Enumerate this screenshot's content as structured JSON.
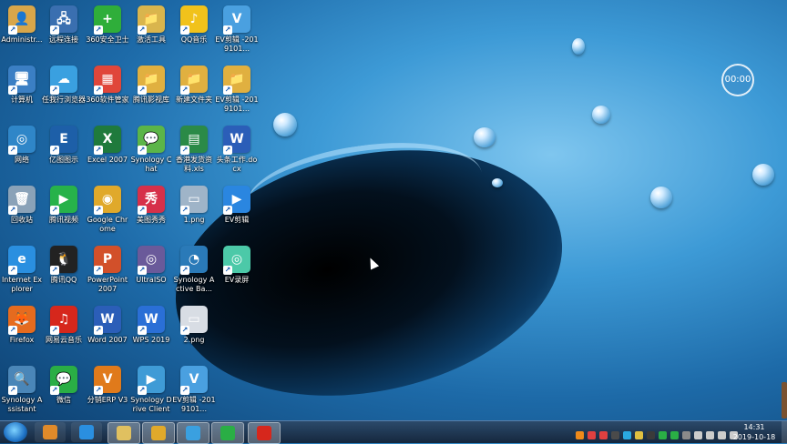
{
  "desktop": {
    "clock_bubble": "00:00",
    "icons": [
      {
        "label": "Administr...",
        "glyph": "👤",
        "color": "#d8a64a",
        "icon": "user-folder-icon"
      },
      {
        "label": "计算机",
        "glyph": "🖥",
        "color": "#3b7fc4",
        "icon": "computer-icon"
      },
      {
        "label": "网络",
        "glyph": "◎",
        "color": "#2f86c8",
        "icon": "network-icon"
      },
      {
        "label": "回收站",
        "glyph": "🗑",
        "color": "#8aa2b8",
        "icon": "recycle-bin-icon"
      },
      {
        "label": "Internet Explorer",
        "glyph": "e",
        "color": "#2a8fe0",
        "icon": "internet-explorer-icon"
      },
      {
        "label": "Firefox",
        "glyph": "🦊",
        "color": "#e56b1f",
        "icon": "firefox-icon"
      },
      {
        "label": "Synology Assistant",
        "glyph": "🔍",
        "color": "#4a86b8",
        "icon": "synology-assistant-icon"
      },
      {
        "label": "远程连接",
        "glyph": "🖧",
        "color": "#3a6fb0",
        "icon": "remote-desktop-icon"
      },
      {
        "label": "任我行浏览器",
        "glyph": "☁",
        "color": "#3aa0e0",
        "icon": "browser-icon"
      },
      {
        "label": "亿图图示",
        "glyph": "E",
        "color": "#1d5fa8",
        "icon": "edraw-icon"
      },
      {
        "label": "腾讯视频",
        "glyph": "▶",
        "color": "#27b24a",
        "icon": "tencent-video-icon"
      },
      {
        "label": "腾讯QQ",
        "glyph": "🐧",
        "color": "#222222",
        "icon": "qq-icon"
      },
      {
        "label": "网易云音乐",
        "glyph": "♫",
        "color": "#d6271c",
        "icon": "netease-music-icon"
      },
      {
        "label": "微信",
        "glyph": "💬",
        "color": "#2aae45",
        "icon": "wechat-icon"
      },
      {
        "label": "360安全卫士",
        "glyph": "+",
        "color": "#2fae3a",
        "icon": "360-security-icon"
      },
      {
        "label": "360软件管家",
        "glyph": "▦",
        "color": "#e0463a",
        "icon": "360-software-icon"
      },
      {
        "label": "Excel 2007",
        "glyph": "X",
        "color": "#1f7a3c",
        "icon": "excel-icon"
      },
      {
        "label": "Google Chrome",
        "glyph": "◉",
        "color": "#e0a92b",
        "icon": "chrome-icon"
      },
      {
        "label": "PowerPoint 2007",
        "glyph": "P",
        "color": "#d2502a",
        "icon": "powerpoint-icon"
      },
      {
        "label": "Word 2007",
        "glyph": "W",
        "color": "#2b5eb8",
        "icon": "word-icon"
      },
      {
        "label": "分销ERP V3",
        "glyph": "V",
        "color": "#e07a1b",
        "icon": "erp-icon"
      },
      {
        "label": "激活工具",
        "glyph": "📁",
        "color": "#d9b54d",
        "icon": "folder-icon"
      },
      {
        "label": "腾讯影视库",
        "glyph": "📁",
        "color": "#e0b040",
        "icon": "folder-icon"
      },
      {
        "label": "Synology Chat",
        "glyph": "💬",
        "color": "#5bb548",
        "icon": "synology-chat-icon"
      },
      {
        "label": "美图秀秀",
        "glyph": "秀",
        "color": "#d6304a",
        "icon": "meitu-icon"
      },
      {
        "label": "UltraISO",
        "glyph": "◎",
        "color": "#6a5a9a",
        "icon": "ultraiso-icon"
      },
      {
        "label": "WPS 2019",
        "glyph": "W",
        "color": "#2a6fd6",
        "icon": "wps-icon"
      },
      {
        "label": "Synology Drive Client",
        "glyph": "▶",
        "color": "#3f9bd6",
        "icon": "synology-drive-icon"
      },
      {
        "label": "QQ音乐",
        "glyph": "♪",
        "color": "#f1c21b",
        "icon": "qq-music-icon"
      },
      {
        "label": "新建文件夹",
        "glyph": "📁",
        "color": "#e0b040",
        "icon": "folder-icon"
      },
      {
        "label": "香港发货资料.xls",
        "glyph": "▤",
        "color": "#2b8a47",
        "icon": "xls-file-icon"
      },
      {
        "label": "1.png",
        "glyph": "▭",
        "color": "#9fb4c8",
        "icon": "image-file-icon"
      },
      {
        "label": "Synology Active Ba...",
        "glyph": "◔",
        "color": "#2a7ab8",
        "icon": "synology-backup-icon"
      },
      {
        "label": "2.png",
        "glyph": "▭",
        "color": "#d8dde4",
        "icon": "image-file-icon"
      },
      {
        "label": "EV剪辑 -2019101...",
        "glyph": "V",
        "color": "#4aa0e0",
        "icon": "ev-file-icon"
      },
      {
        "label": "EV剪辑 -2019101...",
        "glyph": "V",
        "color": "#4aa0e0",
        "icon": "ev-file-icon"
      },
      {
        "label": "EV剪辑 -2019101...",
        "glyph": "📁",
        "color": "#e0b040",
        "icon": "folder-icon"
      },
      {
        "label": "头条工作.docx",
        "glyph": "W",
        "color": "#2b5eb8",
        "icon": "docx-file-icon"
      },
      {
        "label": "EV剪辑",
        "glyph": "▶",
        "color": "#2a86e0",
        "icon": "ev-editor-icon"
      },
      {
        "label": "EV录屏",
        "glyph": "◎",
        "color": "#4cc9a8",
        "icon": "ev-recorder-icon"
      }
    ]
  },
  "taskbar": {
    "items": [
      {
        "icon": "start-orb-icon",
        "color": "#1f73c7"
      },
      {
        "icon": "app-grid-icon",
        "color": "#e08a2a"
      },
      {
        "icon": "internet-explorer-icon",
        "color": "#2a8fe0"
      },
      {
        "icon": "file-explorer-icon",
        "color": "#e0c060"
      },
      {
        "icon": "chrome-icon",
        "color": "#e0a92b"
      },
      {
        "icon": "browser-icon",
        "color": "#3aa0e0"
      },
      {
        "icon": "wechat-icon",
        "color": "#2aae45"
      },
      {
        "icon": "netease-music-icon",
        "color": "#d6271c"
      }
    ],
    "tray": [
      "#f08a1a",
      "#e04040",
      "#e04040",
      "#4a4a4a",
      "#2aa8e0",
      "#e0c040",
      "#3a3a3a",
      "#2aae45",
      "#2aae45",
      "#8a8a8a",
      "#cccccc",
      "#cccccc",
      "#cccccc",
      "#cccccc"
    ],
    "time": "14:31",
    "date": "2019-10-18"
  }
}
